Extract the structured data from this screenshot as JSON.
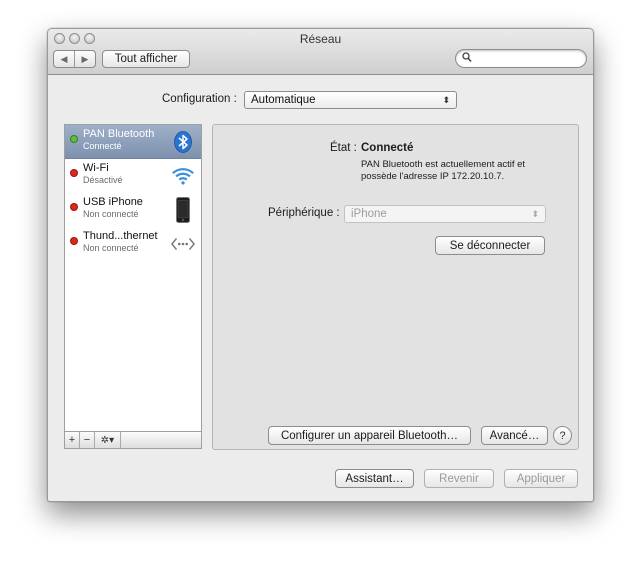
{
  "window": {
    "title": "Réseau",
    "show_all": "Tout afficher",
    "nav_back": "◀",
    "nav_forward": "▶",
    "search": {
      "placeholder": "",
      "value": ""
    }
  },
  "configuration": {
    "label": "Configuration :",
    "value": "Automatique"
  },
  "services": [
    {
      "name": "PAN Bluetooth",
      "status": "Connecté",
      "status_color": "#58c03c",
      "icon": "bluetooth-icon",
      "selected": true
    },
    {
      "name": "Wi-Fi",
      "status": "Désactivé",
      "status_color": "#e0261c",
      "icon": "wifi-icon",
      "selected": false
    },
    {
      "name": "USB iPhone",
      "status": "Non connecté",
      "status_color": "#e0261c",
      "icon": "iphone-icon",
      "selected": false
    },
    {
      "name": "Thund...thernet",
      "status": "Non connecté",
      "status_color": "#e0261c",
      "icon": "thunderbolt-ethernet-icon",
      "selected": false
    }
  ],
  "list_toolbar": {
    "add": "+",
    "remove": "−",
    "gear": "✲▾"
  },
  "detail": {
    "state_label": "État :",
    "state_value": "Connecté",
    "state_desc_line1": "PAN Bluetooth est actuellement actif et",
    "state_desc_line2": "possède l'adresse IP 172.20.10.7.",
    "device_label": "Périphérique :",
    "device_value": "iPhone",
    "disconnect_button": "Se déconnecter",
    "configure_button": "Configurer un appareil Bluetooth…",
    "advanced_button": "Avancé…",
    "help": "?"
  },
  "footer": {
    "assistant": "Assistant…",
    "revert": "Revenir",
    "apply": "Appliquer"
  },
  "colors": {
    "selection": "#8a9cb8",
    "bluetooth_blue": "#2b73d2",
    "wifi_blue": "#3a8fd9"
  }
}
